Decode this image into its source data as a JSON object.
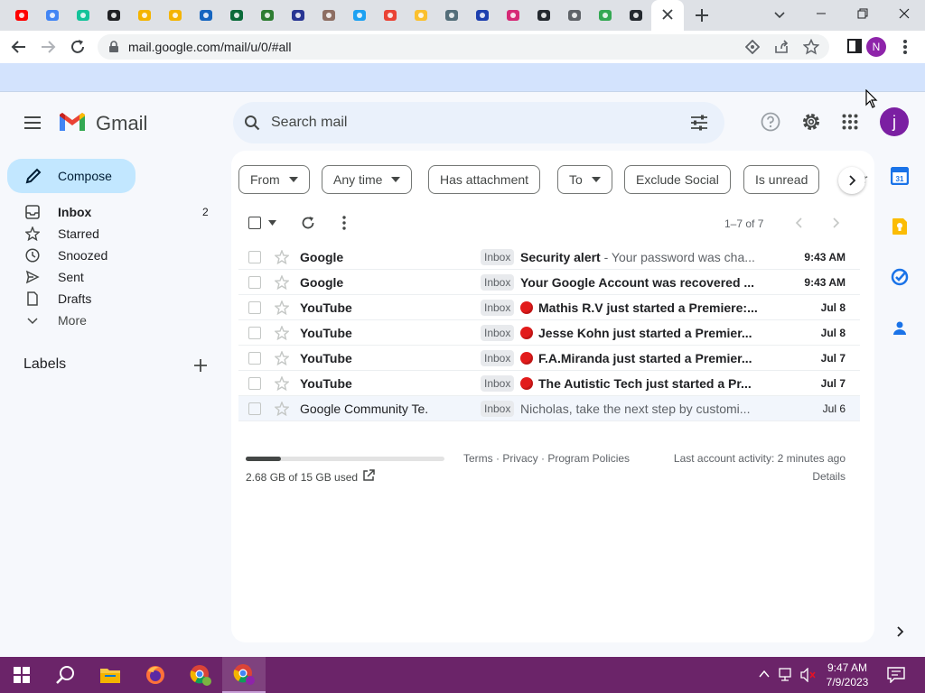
{
  "browser": {
    "url": "mail.google.com/mail/u/0/#all",
    "profile_initial": "N",
    "tab_favicons": [
      {
        "name": "youtube-icon",
        "color": "#ff0000"
      },
      {
        "name": "google-icon",
        "color": "#4285f4"
      },
      {
        "name": "grammarly-icon",
        "color": "#15c39a"
      },
      {
        "name": "settings-gear-icon",
        "color": "#202124"
      },
      {
        "name": "folder-icon",
        "color": "#f4b400"
      },
      {
        "name": "folder-icon",
        "color": "#f4b400"
      },
      {
        "name": "picture-icon",
        "color": "#1565c0"
      },
      {
        "name": "kim-icon",
        "color": "#0b6b3a"
      },
      {
        "name": "puzzle-icon",
        "color": "#2e7d32"
      },
      {
        "name": "sky-icon",
        "color": "#283593"
      },
      {
        "name": "target-icon",
        "color": "#8d6e63"
      },
      {
        "name": "twitter-icon",
        "color": "#1da1f2"
      },
      {
        "name": "gmail-icon",
        "color": "#ea4335"
      },
      {
        "name": "lightbulb-icon",
        "color": "#fbc02d"
      },
      {
        "name": "badge-icon",
        "color": "#546e7a"
      },
      {
        "name": "sonic-icon",
        "color": "#1e40af"
      },
      {
        "name": "instagram-icon",
        "color": "#d62976"
      },
      {
        "name": "github-icon",
        "color": "#24292f"
      },
      {
        "name": "chrome-icon",
        "color": "#5f6368"
      },
      {
        "name": "drive-icon",
        "color": "#34a853"
      },
      {
        "name": "github-icon",
        "color": "#24292f"
      }
    ]
  },
  "gmail": {
    "brand": "Gmail",
    "search_placeholder": "Search mail",
    "account_initial": "j",
    "compose_label": "Compose",
    "nav": [
      {
        "label": "Inbox",
        "count": "2",
        "icon": "inbox-icon",
        "bold": true
      },
      {
        "label": "Starred",
        "count": "",
        "icon": "star-icon"
      },
      {
        "label": "Snoozed",
        "count": "",
        "icon": "clock-icon"
      },
      {
        "label": "Sent",
        "count": "",
        "icon": "send-icon"
      },
      {
        "label": "Drafts",
        "count": "",
        "icon": "draft-icon"
      },
      {
        "label": "More",
        "count": "",
        "icon": "chevron-down-icon"
      }
    ],
    "labels_heading": "Labels",
    "filters": [
      "From",
      "Any time",
      "Has attachment",
      "To",
      "Exclude Social",
      "Is unread"
    ],
    "filter_more_partial": "ur",
    "pagination": "1–7 of 7",
    "emails": [
      {
        "sender": "Google",
        "label": "Inbox",
        "dot": false,
        "subject": "Security alert",
        "snippet": " - Your password was cha...",
        "date": "9:43 AM",
        "unread": true
      },
      {
        "sender": "Google",
        "label": "Inbox",
        "dot": false,
        "subject": "Your Google Account was recovered ...",
        "snippet": "",
        "date": "9:43 AM",
        "unread": true
      },
      {
        "sender": "YouTube",
        "label": "Inbox",
        "dot": true,
        "subject": "Mathis R.V just started a Premiere:...",
        "snippet": "",
        "date": "Jul 8",
        "unread": true
      },
      {
        "sender": "YouTube",
        "label": "Inbox",
        "dot": true,
        "subject": "Jesse Kohn just started a Premier...",
        "snippet": "",
        "date": "Jul 8",
        "unread": true
      },
      {
        "sender": "YouTube",
        "label": "Inbox",
        "dot": true,
        "subject": "F.A.Miranda just started a Premier...",
        "snippet": "",
        "date": "Jul 7",
        "unread": true
      },
      {
        "sender": "YouTube",
        "label": "Inbox",
        "dot": true,
        "subject": "The Autistic Tech just started a Pr...",
        "snippet": "",
        "date": "Jul 7",
        "unread": true
      },
      {
        "sender": "Google Community Te.",
        "label": "Inbox",
        "dot": false,
        "subject": "",
        "snippet": "Nicholas, take the next step by customi...",
        "date": "Jul 6",
        "unread": false
      }
    ],
    "footer": {
      "storage": "2.68 GB of 15 GB used",
      "storage_fraction": 0.179,
      "terms": "Terms · Privacy · Program Policies",
      "activity": "Last account activity: 2 minutes ago",
      "details": "Details"
    }
  },
  "taskbar": {
    "time": "9:47 AM",
    "date": "7/9/2023"
  }
}
